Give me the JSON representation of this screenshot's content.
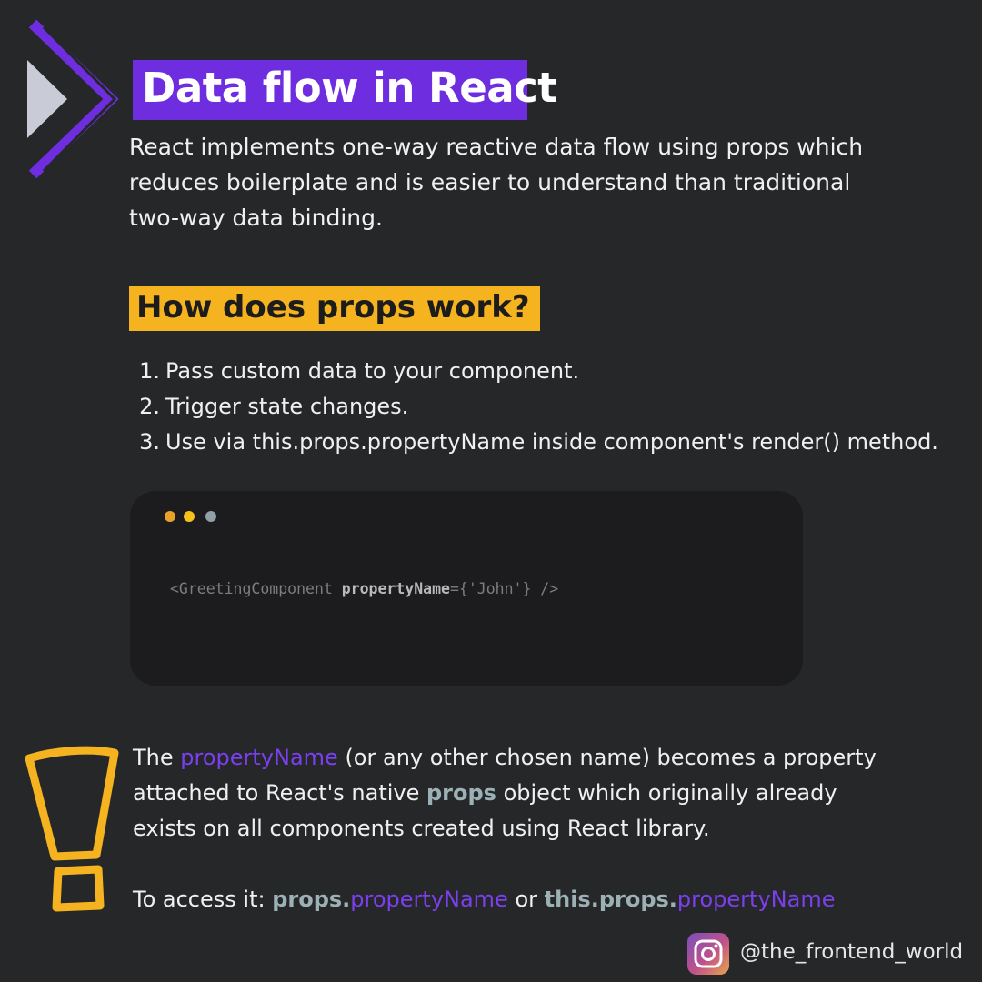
{
  "title": "Data flow in React",
  "intro": {
    "lines": [
      "React implements one-way reactive data flow using props which",
      "reduces boilerplate and is easier to understand than traditional",
      "two-way data binding."
    ]
  },
  "section_heading": "How does props work?",
  "steps": [
    {
      "num": "1.",
      "text": "Pass custom data to your component."
    },
    {
      "num": "2.",
      "text": "Trigger state changes."
    },
    {
      "num": "3.",
      "text": "Use via this.props.propertyName inside component's render() method."
    }
  ],
  "code": {
    "before": "<GreetingComponent ",
    "prop": "propertyName",
    "after": "={'John'} />"
  },
  "note": {
    "line1_a": "The ",
    "line1_hl": "propertyName",
    "line1_b": " (or any other chosen name) becomes a property",
    "line2_a": "attached to React's native ",
    "line2_hl": "props",
    "line2_b": " object which originally already",
    "line3": "exists on all components created using React library."
  },
  "access": {
    "label": "To access it: ",
    "part1_props": "props.",
    "part1_name": "propertyName",
    "or": " or ",
    "part2_props": "this.props.",
    "part2_name": "propertyName"
  },
  "footer": {
    "icon": "instagram-icon",
    "handle": "@the_frontend_world"
  },
  "colors": {
    "background": "#262729",
    "title_bg": "#6e2ee0",
    "heading_bg": "#f5b41f",
    "accent_purple": "#7b3ff0",
    "accent_grey": "#9cb1b5",
    "code_bg": "#1c1c1e"
  }
}
